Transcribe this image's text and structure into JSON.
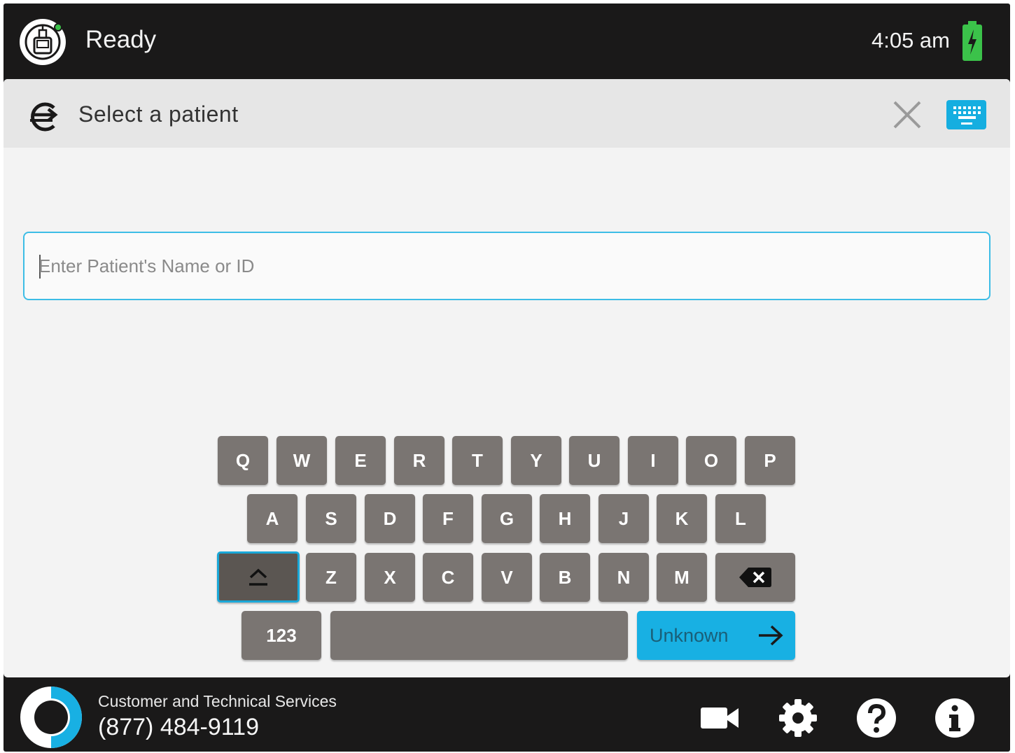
{
  "status_bar": {
    "status": "Ready",
    "time": "4:05 am",
    "device_icon": "pump-icon",
    "battery_icon": "battery-charging-icon",
    "battery_color": "#3bc24a"
  },
  "panel": {
    "title": "Select a patient",
    "back_icon": "back-arrow-icon",
    "close_icon": "close-icon",
    "keyboard_icon": "keyboard-icon"
  },
  "search": {
    "placeholder": "Enter Patient's Name or ID",
    "value": ""
  },
  "keyboard": {
    "row1": [
      "Q",
      "W",
      "E",
      "R",
      "T",
      "Y",
      "U",
      "I",
      "O",
      "P"
    ],
    "row2": [
      "A",
      "S",
      "D",
      "F",
      "G",
      "H",
      "J",
      "K",
      "L"
    ],
    "row3": [
      "Z",
      "X",
      "C",
      "V",
      "B",
      "N",
      "M"
    ],
    "numbers_label": "123",
    "enter_label": "Unknown",
    "accent_color": "#18b0e3"
  },
  "footer": {
    "support_label": "Customer and Technical Services",
    "support_phone": "(877) 484-9119",
    "icons": [
      "video-camera-icon",
      "settings-gear-icon",
      "help-icon",
      "info-icon"
    ]
  }
}
